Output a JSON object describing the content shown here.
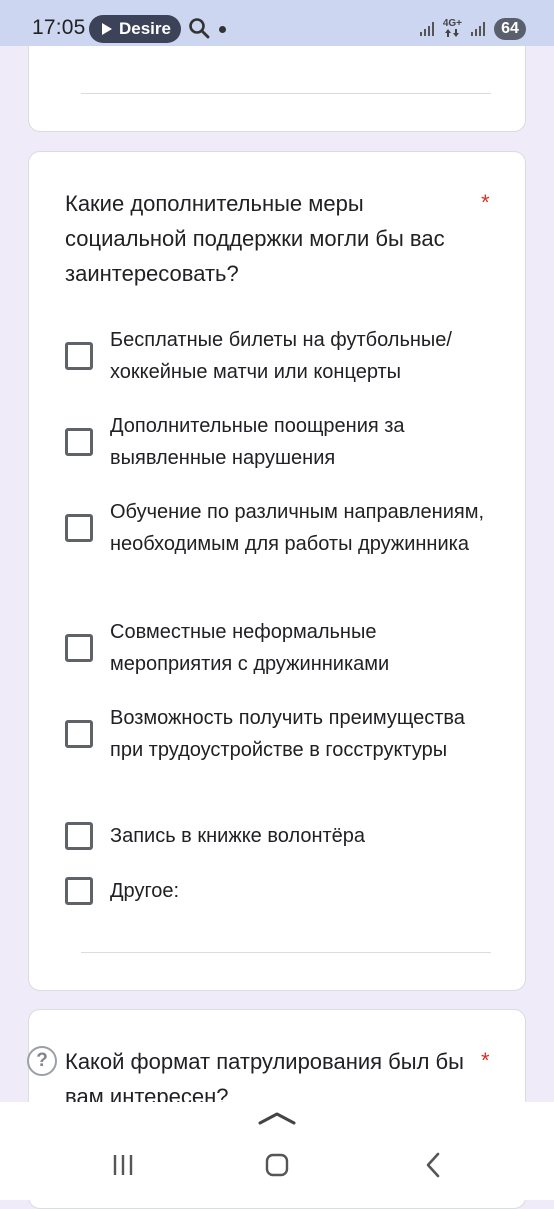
{
  "status_bar": {
    "time": "17:05",
    "media_label": "Desire",
    "network_type": "4G+",
    "battery": "64"
  },
  "question": {
    "title": "Какие дополнительные меры социальной поддержки могли бы вас заинтересовать?",
    "required_mark": "*",
    "options": [
      "Бесплатные билеты на футбольные/ хоккейные матчи или концерты",
      "Дополнительные поощрения за выявленные нарушения",
      "Обучение по различным направлениям, необходимым для работы дружинника",
      "Совместные неформальные мероприятия с дружинниками",
      "Возможность получить преимущества при трудоустройстве в госструктуры",
      "Запись в книжке волонтёра",
      "Другое:"
    ]
  },
  "next_question": {
    "title": "Какой формат патрулирования был бы вам интересен?",
    "required_mark": "*",
    "help_symbol": "?"
  },
  "colors": {
    "page_background": "#f0ebf8",
    "status_bar": "#ccd6f0",
    "required": "#d93025",
    "checkbox_border": "#5f6368"
  }
}
